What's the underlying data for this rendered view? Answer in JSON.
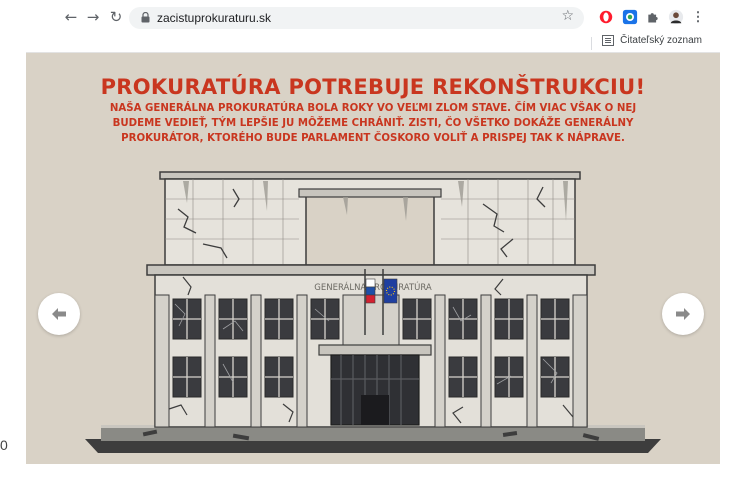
{
  "browser": {
    "url": "zacistuprokuraturu.sk",
    "reading_list_label": "Čitateľský zoznam",
    "icons": [
      "back-icon",
      "forward-icon",
      "reload-icon",
      "lock-icon",
      "star-icon",
      "opera-icon",
      "extension-blue-icon",
      "puzzle-icon",
      "profile-icon",
      "menu-icon"
    ]
  },
  "page": {
    "headline": "PROKURATÚRA POTREBUJE REKONŠTRUKCIU!",
    "subtext": "NAŠA GENERÁLNA PROKURATÚRA BOLA ROKY VO VEĽMI ZLOM STAVE. ČÍM VIAC VŠAK O NEJ BUDEME VEDIEŤ, TÝM LEPŠIE JU MÔŽEME CHRÁNIŤ. ZISTI, ČO VŠETKO DOKÁŽE GENERÁLNY PROKURÁTOR, KTORÉHO BUDE PARLAMENT ČOSKORO VOLIŤ A PRISPEJ TAK K NÁPRAVE.",
    "building_sign": "GENERÁLNA PROKURATÚRA",
    "prev_icon": "arrow-left-icon",
    "next_icon": "arrow-right-icon"
  },
  "edge_text": "0",
  "colors": {
    "accent": "#c9361f",
    "background": "#d9d2c6"
  }
}
